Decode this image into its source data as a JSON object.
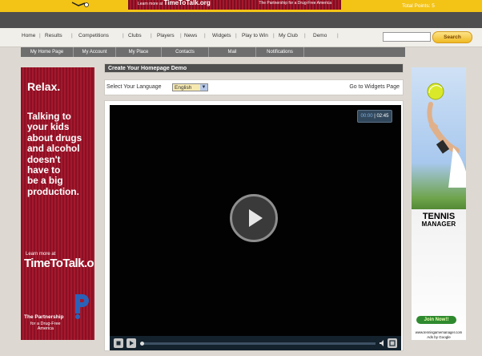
{
  "header": {
    "banner_learn": "Learn more at",
    "banner_logo": "TimeToTalk.org",
    "banner_partner": "The Partnership for a Drug-Free America",
    "total_points": "Total Points: 5"
  },
  "nav": {
    "items": [
      "Home",
      "Results",
      "Competitions",
      "Clubs",
      "Players",
      "News",
      "Widgets",
      "Play to Win",
      "My Club",
      "Demo"
    ],
    "search_placeholder": "",
    "search_label": "Search"
  },
  "subnav": [
    "My Home Page",
    "My Account",
    "My Place",
    "Contacts",
    "Mail",
    "Notifications"
  ],
  "panel": {
    "title": "Create Your Homepage Demo",
    "language_label": "Select Your Language",
    "language_value": "English",
    "widgets_link": "Go to Widgets Page"
  },
  "video": {
    "current_time": "00:00",
    "duration": "02:45",
    "progress": 0
  },
  "left_ad": {
    "headline": "Relax.",
    "message_lines": [
      "Talking to",
      "your kids",
      "about drugs",
      "and alcohol",
      "doesn't",
      "have to",
      "be a big",
      "production."
    ],
    "learn_more": "Learn more at",
    "site": "TimeToTalk.org",
    "partner": "The Partnership",
    "partner_sub_1": "for a Drug-Free",
    "partner_sub_2": "America"
  },
  "right_ad": {
    "title_1": "TENNIS",
    "title_2": "MANAGER",
    "cta": "Join Now!!",
    "url": "www.tennisgamemanager.com",
    "ads_by": "Ads by Google"
  },
  "colors": {
    "accent_yellow": "#f3c316",
    "header_dark": "#4f4f4f",
    "ad_red": "#a5182d"
  }
}
